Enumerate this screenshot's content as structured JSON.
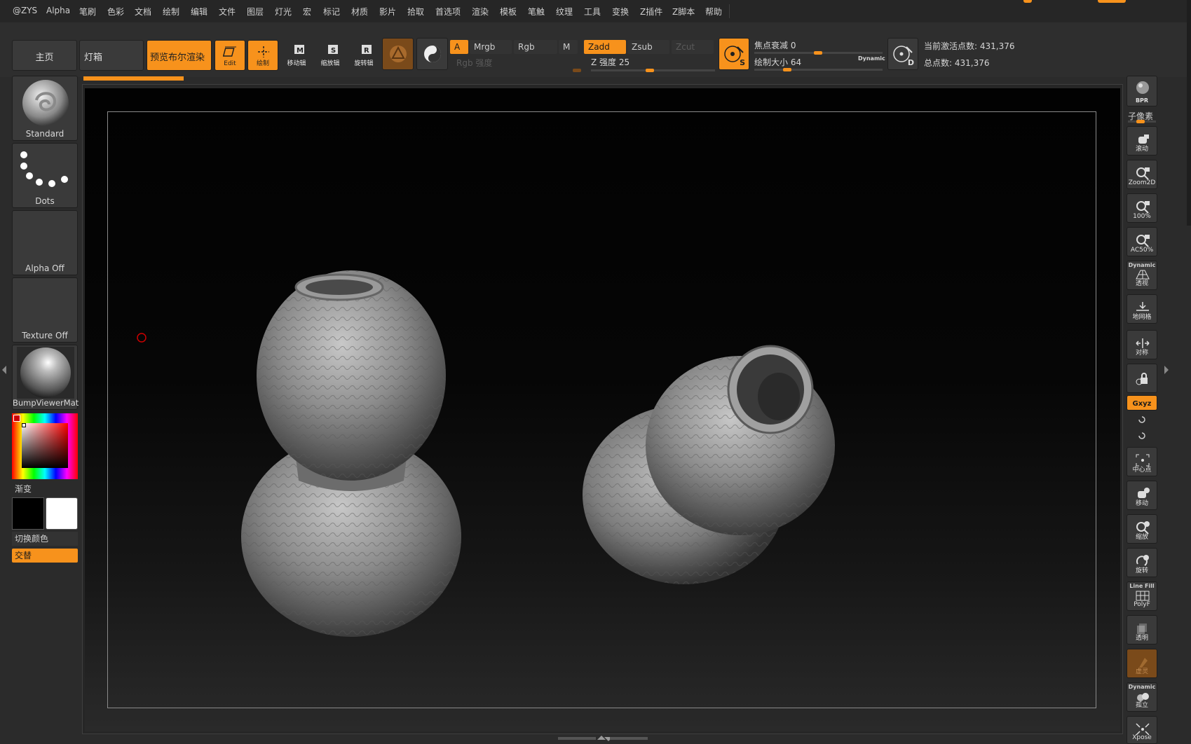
{
  "menu": [
    "@ZYS",
    "Alpha",
    "笔刷",
    "色彩",
    "文档",
    "绘制",
    "编辑",
    "文件",
    "图层",
    "灯光",
    "宏",
    "标记",
    "材质",
    "影片",
    "拾取",
    "首选项",
    "渲染",
    "模板",
    "笔触",
    "纹理",
    "工具",
    "变换",
    "Z插件",
    "Z脚本",
    "帮助"
  ],
  "toolbar": {
    "home": "主页",
    "lightbox": "灯箱",
    "bpr_preview": "预览布尔渲染",
    "edit": "Edit",
    "draw": "绘制",
    "move": "移动辑",
    "scale": "缩放辑",
    "rotate": "旋转辑",
    "a_chip": "A",
    "mrgb": "Mrgb",
    "rgb": "Rgb",
    "m": "M",
    "zadd": "Zadd",
    "zsub": "Zsub",
    "zcut": "Zcut",
    "rgb_intensity": "Rgb 强度",
    "z_intensity": "Z 强度 25",
    "focal_shift": "焦点衰减 0",
    "draw_size": "绘制大小 64",
    "dynamic": "Dynamic",
    "active_points": "当前激活点数: 431,376",
    "total_points": "总点数: 431,376",
    "s_letter": "S",
    "d_letter": "D"
  },
  "left_panel": {
    "brush": "Standard",
    "stroke": "Dots",
    "alpha": "Alpha Off",
    "texture": "Texture Off",
    "material": "BumpViewerMat",
    "gradient": "渐变",
    "switch_color": "切换颜色",
    "alternate": "交替"
  },
  "right_shelf": {
    "bpr": "BPR",
    "subpixel": "子像素",
    "scroll": "滚动",
    "zoom2d": "Zoom2D",
    "zoom100": "100%",
    "ac50": "AC50%",
    "persp_top": "Dynamic",
    "persp": "透视",
    "floor": "地网格",
    "local_sym": "对称",
    "lock": "",
    "xyz": "Gxyz",
    "center": "中心点",
    "move": "移动",
    "scale": "缩放",
    "rotate": "旋转",
    "linefill_top": "Line Fill",
    "polyf": "PolyF",
    "transp": "透明",
    "ghost": "虚灵",
    "solo_top": "Dynamic",
    "solo": "孤立",
    "xpose": "Xpose"
  },
  "colors": {
    "accent": "#f7921c",
    "primary": "#000000",
    "secondary": "#ffffff"
  }
}
